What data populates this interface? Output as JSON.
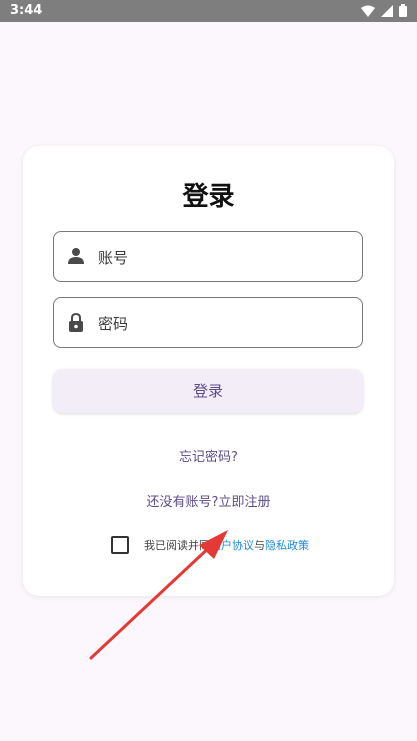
{
  "status_bar": {
    "time": "3:44"
  },
  "login": {
    "title": "登录",
    "account_placeholder": "账号",
    "password_placeholder": "密码",
    "login_button": "登录",
    "forgot_password": "忘记密码?",
    "register_prompt": "还没有账号?立即注册",
    "agreement_prefix": "我已阅读并同",
    "user_agreement": "用户协议",
    "and": "与",
    "privacy_policy": "隐私政策"
  },
  "colors": {
    "background": "#fcf7fc",
    "accent": "#5c4c8a",
    "button_bg": "#f3edf7",
    "link": "#1e88e5",
    "arrow": "#e53935"
  }
}
